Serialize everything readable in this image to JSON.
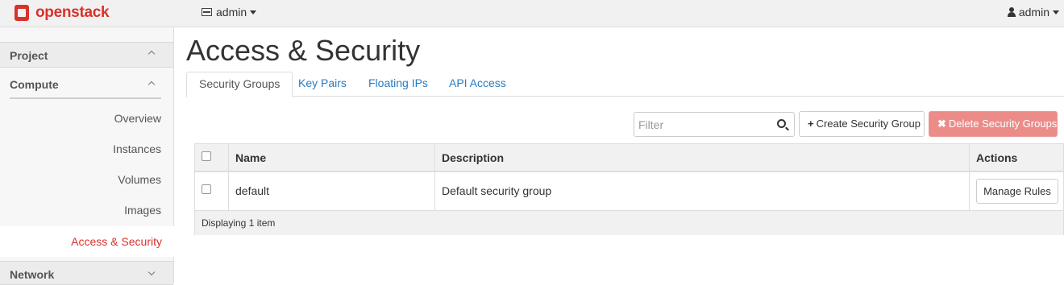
{
  "header": {
    "brand": "openstack",
    "project_menu": "admin",
    "user_menu": "admin"
  },
  "sidebar": {
    "project_label": "Project",
    "compute_label": "Compute",
    "items": [
      {
        "label": "Overview",
        "active": false
      },
      {
        "label": "Instances",
        "active": false
      },
      {
        "label": "Volumes",
        "active": false
      },
      {
        "label": "Images",
        "active": false
      },
      {
        "label": "Access & Security",
        "active": true
      }
    ],
    "network_label": "Network"
  },
  "main": {
    "title": "Access & Security",
    "tabs": [
      {
        "label": "Security Groups",
        "active": true
      },
      {
        "label": "Key Pairs",
        "active": false
      },
      {
        "label": "Floating IPs",
        "active": false
      },
      {
        "label": "API Access",
        "active": false
      }
    ],
    "filter_placeholder": "Filter",
    "create_button": "Create Security Group",
    "delete_button": "Delete Security Groups",
    "table": {
      "columns": [
        "Name",
        "Description",
        "Actions"
      ],
      "rows": [
        {
          "name": "default",
          "description": "Default security group",
          "action": "Manage Rules"
        }
      ],
      "footer": "Displaying 1 item"
    }
  },
  "colors": {
    "brand": "#d9312b",
    "link": "#2a7bc0",
    "danger_button": "#eb8c89"
  }
}
